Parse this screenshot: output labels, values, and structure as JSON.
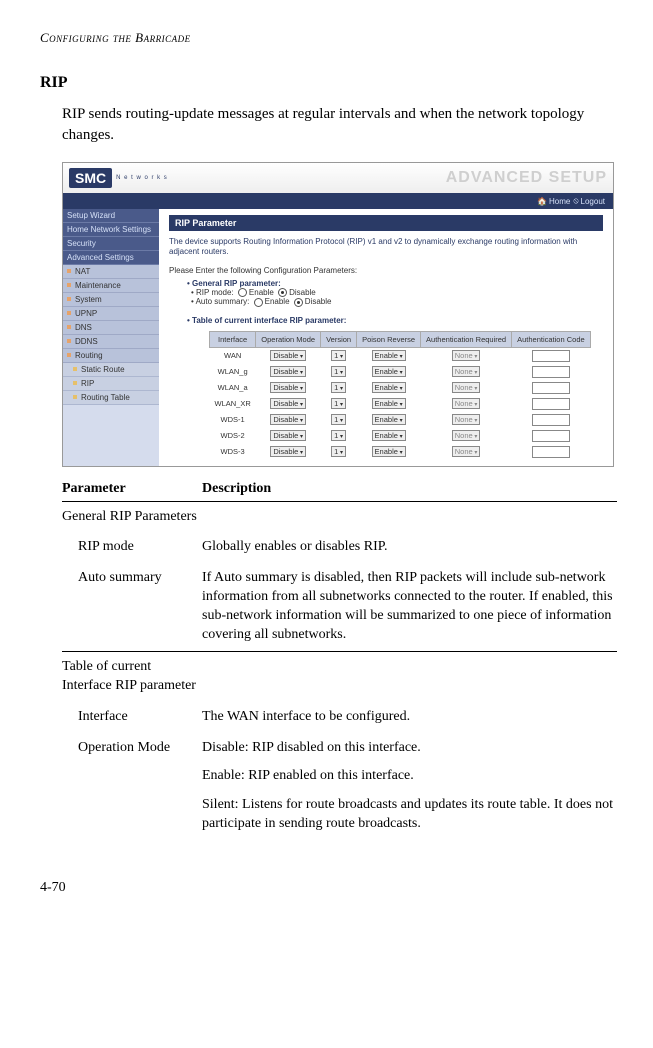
{
  "running_head": "Configuring the Barricade",
  "section_title": "RIP",
  "body_text": "RIP sends routing-update messages at regular intervals and when the network topology changes.",
  "screenshot": {
    "logo_text": "SMC",
    "logo_sub": "N e t w o r k s",
    "banner_title": "ADVANCED SETUP",
    "homebar": {
      "home": "Home",
      "logout": "Logout"
    },
    "sidebar": {
      "main": [
        "Setup Wizard",
        "Home Network Settings",
        "Security",
        "Advanced Settings"
      ],
      "subs": [
        "NAT",
        "Maintenance",
        "System",
        "UPNP",
        "DNS",
        "DDNS",
        "Routing"
      ],
      "subsubs": [
        "Static Route",
        "RIP",
        "Routing Table"
      ]
    },
    "panel": {
      "title": "RIP Parameter",
      "note": "The device supports Routing Information Protocol (RIP) v1 and v2 to dynamically exchange routing information with adjacent routers.",
      "intro": "Please Enter the following Configuration Parameters:",
      "group1_title": "General RIP parameter:",
      "group1_items": [
        {
          "label": "RIP mode:",
          "opt1": "Enable",
          "opt2": "Disable",
          "selected": "Disable"
        },
        {
          "label": "Auto summary:",
          "opt1": "Enable",
          "opt2": "Disable",
          "selected": "Disable"
        }
      ],
      "group2_title": "Table of current interface RIP parameter:",
      "table": {
        "headers": [
          "Interface",
          "Operation Mode",
          "Version",
          "Poison Reverse",
          "Authentication Required",
          "Authentication Code"
        ],
        "rows": [
          {
            "if": "WAN",
            "op": "Disable",
            "ver": "1",
            "pr": "Enable",
            "auth": "None"
          },
          {
            "if": "WLAN_g",
            "op": "Disable",
            "ver": "1",
            "pr": "Enable",
            "auth": "None"
          },
          {
            "if": "WLAN_a",
            "op": "Disable",
            "ver": "1",
            "pr": "Enable",
            "auth": "None"
          },
          {
            "if": "WLAN_XR",
            "op": "Disable",
            "ver": "1",
            "pr": "Enable",
            "auth": "None"
          },
          {
            "if": "WDS-1",
            "op": "Disable",
            "ver": "1",
            "pr": "Enable",
            "auth": "None"
          },
          {
            "if": "WDS-2",
            "op": "Disable",
            "ver": "1",
            "pr": "Enable",
            "auth": "None"
          },
          {
            "if": "WDS-3",
            "op": "Disable",
            "ver": "1",
            "pr": "Enable",
            "auth": "None"
          }
        ]
      }
    }
  },
  "param_table": {
    "header_param": "Parameter",
    "header_desc": "Description",
    "rows": [
      {
        "param": "General RIP Parameters",
        "desc": "",
        "header": true,
        "first": true
      },
      {
        "param": "RIP mode",
        "desc": "Globally enables or disables RIP.",
        "indent": true
      },
      {
        "param": "Auto summary",
        "desc": "If Auto summary is disabled, then RIP packets will include sub-network information from all subnetworks connected to the router. If enabled, this sub-network information will be summarized to one piece of information covering all subnetworks.",
        "indent": true
      },
      {
        "param": "Table of current Interface RIP parameter",
        "desc": "",
        "header": true
      },
      {
        "param": "Interface",
        "desc": "The WAN interface to be configured.",
        "indent": true
      },
      {
        "param": "Operation Mode",
        "desc_multi": [
          "Disable: RIP disabled on this interface.",
          "Enable: RIP enabled on this interface.",
          "Silent: Listens for route broadcasts and updates its route table. It does not participate in sending route broadcasts."
        ],
        "indent": true
      }
    ]
  },
  "page_num": "4-70"
}
